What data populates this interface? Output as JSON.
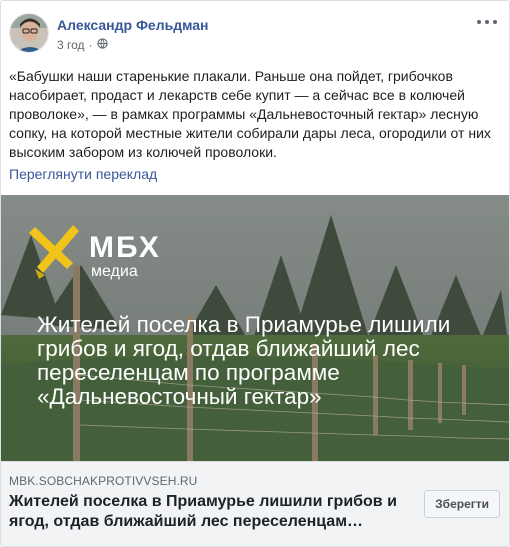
{
  "post": {
    "author": "Александр Фельдман",
    "time": "3 год",
    "text": "«Бабушки наши старенькие плакали. Раньше она пойдет, грибочков насобирает, продаст и лекарств себе купит — а сейчас все в колючей проволоке», — в рамках программы «Дальневосточный гектар» лесную сопку, на которой местные жители собирали дары леса, огородили от них высоким забором из колючей проволоки.",
    "translate_label": "Переглянути переклад"
  },
  "link_image": {
    "logo_main": "МБХ",
    "logo_sub": "медиа",
    "headline_lines": [
      "Жителей поселка в Приамурье лишили",
      "грибов и ягод, отдав ближайший лес",
      "переселенцам по программе",
      "«Дальневосточный гектар»"
    ]
  },
  "link": {
    "domain": "MBK.SOBCHAKPROTIVVSEH.RU",
    "title": "Жителей поселка в Приамурье лишили грибов и ягод, отдав ближайший лес переселенцам…",
    "save_label": "Зберегти"
  },
  "icons": {
    "privacy": "globe-icon",
    "more": "more-options-icon"
  },
  "colors": {
    "link_blue": "#385898",
    "logo_yellow": "#f0c419"
  }
}
